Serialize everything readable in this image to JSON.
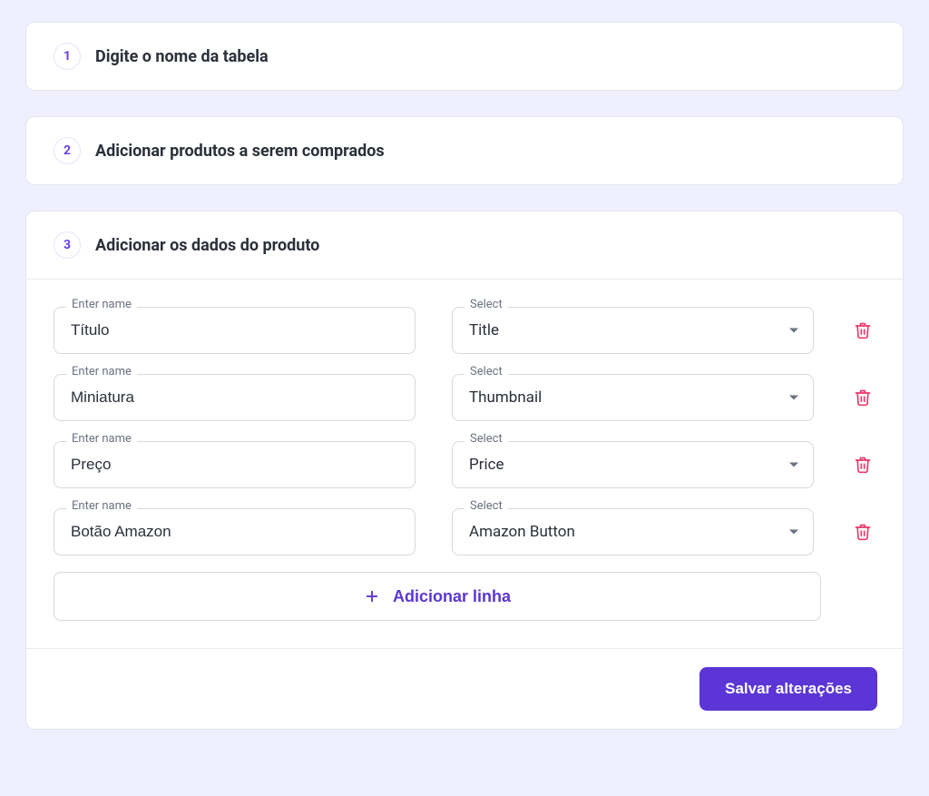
{
  "steps": {
    "one": {
      "number": "1",
      "title": "Digite o nome da tabela"
    },
    "two": {
      "number": "2",
      "title": "Adicionar produtos a serem comprados"
    },
    "three": {
      "number": "3",
      "title": "Adicionar os dados do produto"
    }
  },
  "labels": {
    "enter_name": "Enter name",
    "select": "Select"
  },
  "rows": [
    {
      "name": "Título",
      "select": "Title"
    },
    {
      "name": "Miniatura",
      "select": "Thumbnail"
    },
    {
      "name": "Preço",
      "select": "Price"
    },
    {
      "name": "Botão Amazon",
      "select": "Amazon Button"
    }
  ],
  "buttons": {
    "add_row": "Adicionar linha",
    "save": "Salvar alterações"
  },
  "colors": {
    "accent": "#5b35d5",
    "delete": "#e93a6b"
  }
}
